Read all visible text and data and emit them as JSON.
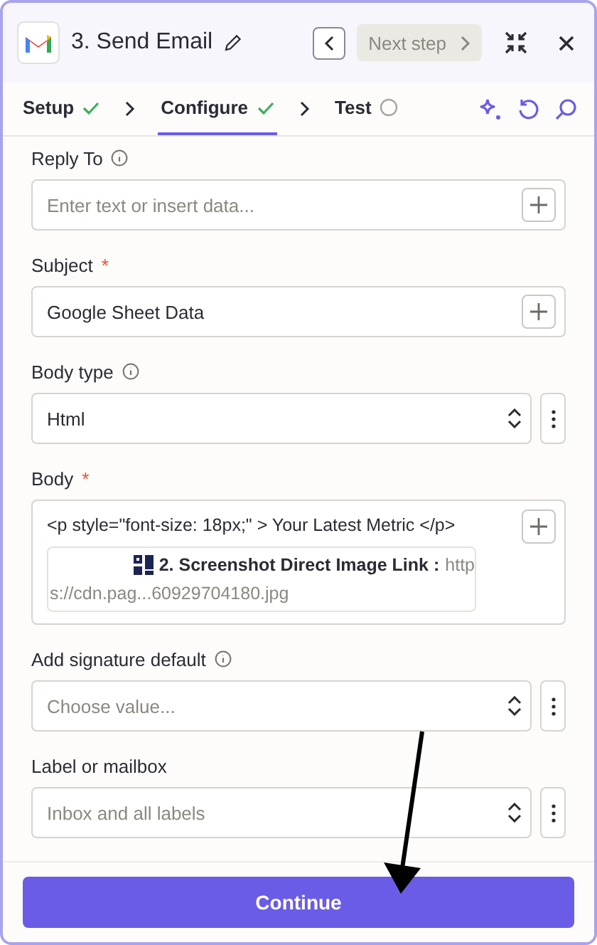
{
  "header": {
    "title": "3. Send Email",
    "next_step": "Next step"
  },
  "steps": [
    {
      "label": "Setup",
      "selected": false,
      "done": true
    },
    {
      "label": "Configure",
      "selected": true,
      "done": true
    },
    {
      "label": "Test",
      "selected": false,
      "done": false
    }
  ],
  "fields": [
    {
      "kind": "text",
      "label": "Reply To",
      "info": true,
      "placeholder": "Enter text or insert data..."
    },
    {
      "kind": "text",
      "label": "Subject",
      "required_mark": "*",
      "info": false,
      "value": "Google Sheet Data"
    },
    {
      "kind": "select",
      "label": "Body type",
      "info": true,
      "value": "Html"
    },
    {
      "kind": "body",
      "label": "Body",
      "required_mark": "*",
      "info": false,
      "value": "<p style=\"font-size: 18px;\" > Your Latest Metric </p>",
      "pill_label": "2. Screenshot Direct Image Link :",
      "pill_value_start": "http",
      "pill_value_end": "s://cdn.pag...60929704180.jpg"
    },
    {
      "kind": "select",
      "label": "Add signature default",
      "info": true,
      "placeholder": "Choose value..."
    },
    {
      "kind": "select",
      "label": "Label or mailbox",
      "info": false,
      "placeholder": "Inbox and all labels"
    }
  ],
  "continue_button": "Continue"
}
